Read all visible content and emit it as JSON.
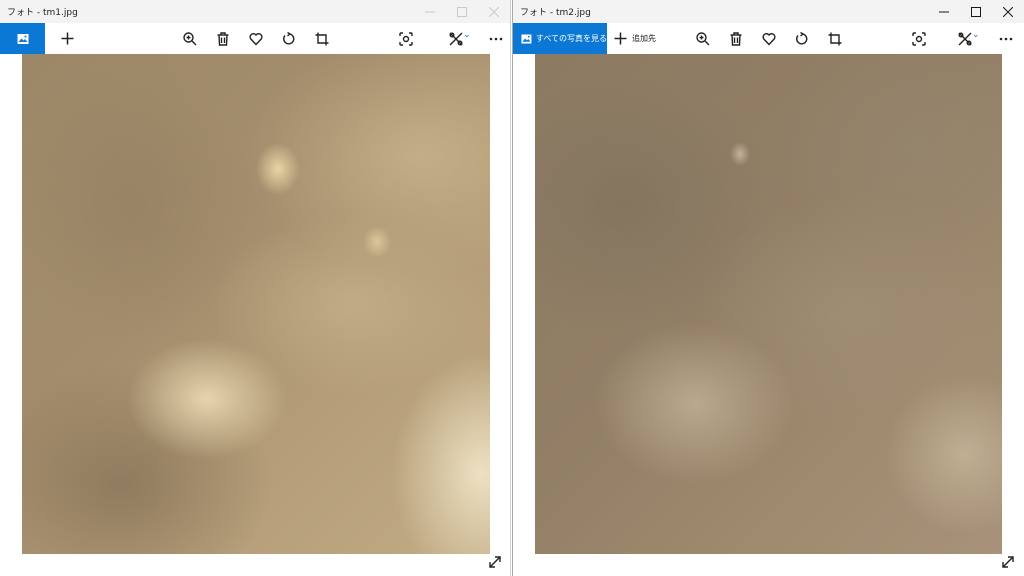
{
  "windows": [
    {
      "title": "フォト - tm1.jpg",
      "state": "inactive",
      "toolbar": {
        "albums_label": "",
        "add_label": ""
      }
    },
    {
      "title": "フォト - tm2.jpg",
      "state": "active",
      "toolbar": {
        "albums_label": "すべての写真を見る",
        "add_label": "追加先"
      }
    }
  ],
  "icons": {
    "albums": "photo-album-icon",
    "add": "plus-icon",
    "zoom": "zoom-in-icon",
    "delete": "trash-icon",
    "favorite": "heart-icon",
    "rotate": "rotate-icon",
    "crop": "crop-icon",
    "enhance": "enhance-icon",
    "edit": "edit-create-icon",
    "more": "more-options-icon",
    "fullscreen": "fullscreen-icon"
  },
  "colors": {
    "accent": "#0a78d4",
    "titlebar": "#f3f3f3",
    "toolbar": "#ffffff"
  }
}
